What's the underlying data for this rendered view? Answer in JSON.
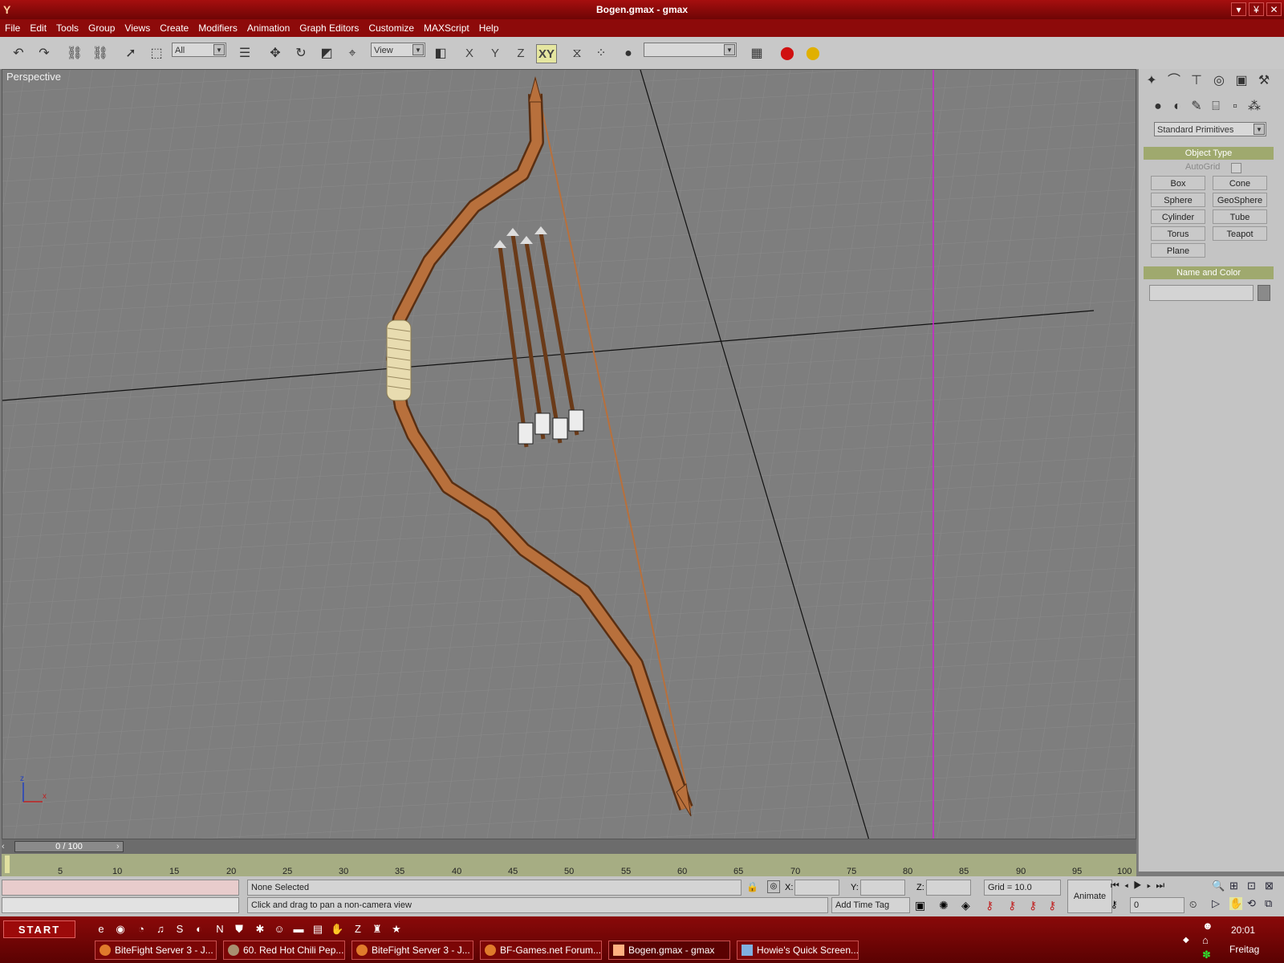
{
  "window": {
    "title": "Bogen.gmax - gmax"
  },
  "menu": [
    "File",
    "Edit",
    "Tools",
    "Group",
    "Views",
    "Create",
    "Modifiers",
    "Animation",
    "Graph Editors",
    "Customize",
    "MAXScript",
    "Help"
  ],
  "toolbar": {
    "selection_filter": "All",
    "ref_coord": "View",
    "axis_x": "X",
    "axis_y": "Y",
    "axis_z": "Z",
    "axis_xy": "XY",
    "named_sel": ""
  },
  "viewport": {
    "label": "Perspective"
  },
  "command_panel": {
    "category": "Standard Primitives",
    "object_type_title": "Object Type",
    "autogrid_label": "AutoGrid",
    "buttons": [
      "Box",
      "Cone",
      "Sphere",
      "GeoSphere",
      "Cylinder",
      "Tube",
      "Torus",
      "Teapot",
      "Plane"
    ],
    "name_color_title": "Name and Color",
    "name_value": ""
  },
  "timeline": {
    "frame_display": "0 / 100",
    "ticks": [
      "5",
      "10",
      "15",
      "20",
      "25",
      "30",
      "35",
      "40",
      "45",
      "50",
      "55",
      "60",
      "65",
      "70",
      "75",
      "80",
      "85",
      "90",
      "95",
      "100"
    ]
  },
  "status": {
    "selection": "None Selected",
    "prompt": "Click and drag to pan a non-camera view",
    "x_label": "X:",
    "y_label": "Y:",
    "z_label": "Z:",
    "grid": "Grid = 10.0",
    "animate": "Animate",
    "add_time_tag": "Add Time Tag",
    "frame_field": "0"
  },
  "taskbar": {
    "start": "START",
    "clock": "20:01",
    "day": "Freitag",
    "tasks": [
      "BiteFight Server 3 - J...",
      "60. Red Hot Chili Pep...",
      "BiteFight Server 3 - J...",
      "BF-Games.net Forum...",
      "Bogen.gmax - gmax",
      "Howie's Quick Screen..."
    ]
  },
  "colors": {
    "titlebar": "#8d0a0a",
    "viewport_bg": "#7e7e7e",
    "bow_wood": "#b8703c",
    "rollout_header": "#9fa96e",
    "timeline_track": "#a6ad83"
  }
}
